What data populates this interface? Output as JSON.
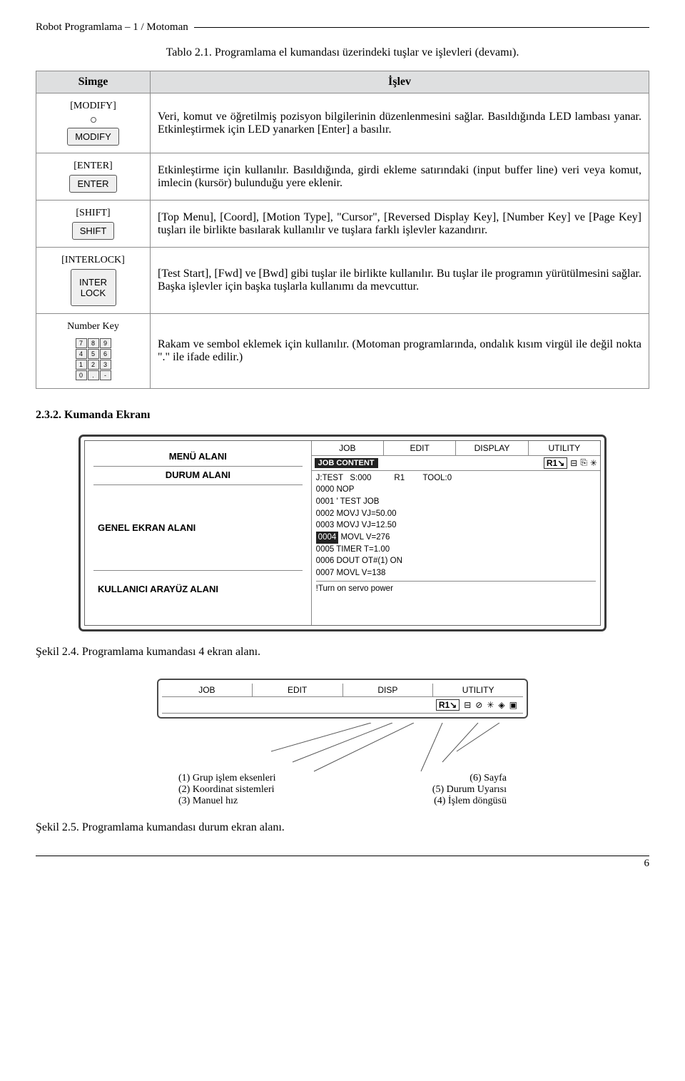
{
  "header": "Robot Programlama – 1 / Motoman",
  "table_caption": "Tablo 2.1. Programlama el kumandası üzerindeki tuşlar ve işlevleri (devamı).",
  "table": {
    "headers": {
      "col1": "Simge",
      "col2": "İşlev"
    },
    "rows": [
      {
        "icon_label": "[MODIFY]",
        "btn_text": "MODIFY",
        "has_led": true,
        "desc": "Veri, komut ve öğretilmiş pozisyon bilgilerinin düzenlenmesini sağlar. Basıldığında LED lambası yanar. Etkinleştirmek için LED yanarken [Enter] a basılır."
      },
      {
        "icon_label": "[ENTER]",
        "btn_text": "ENTER",
        "has_led": false,
        "desc": "Etkinleştirme için kullanılır. Basıldığında, girdi ekleme satırındaki (input buffer line) veri veya komut, imlecin (kursör) bulunduğu yere eklenir."
      },
      {
        "icon_label": "[SHIFT]",
        "btn_text": "SHIFT",
        "has_led": false,
        "desc": "[Top Menu], [Coord], [Motion Type], \"Cursor\", [Reversed Display Key], [Number Key] ve [Page Key] tuşları ile birlikte basılarak kullanılır ve tuşlara farklı işlevler kazandırır."
      },
      {
        "icon_label": "[INTERLOCK]",
        "btn_text_1": "INTER",
        "btn_text_2": "LOCK",
        "tall": true,
        "desc": "[Test Start], [Fwd] ve [Bwd] gibi tuşlar ile birlikte kullanılır. Bu tuşlar ile programın yürütülmesini sağlar. Başka işlevler için başka tuşlarla kullanımı da mevcuttur."
      },
      {
        "icon_label": "Number Key",
        "numpad": [
          [
            "7",
            "8",
            "9"
          ],
          [
            "4",
            "5",
            "6"
          ],
          [
            "1",
            "2",
            "3"
          ],
          [
            "0",
            ".",
            "-"
          ]
        ],
        "desc": "Rakam ve sembol eklemek için kullanılır. (Motoman programlarında, ondalık kısım virgül ile değil nokta \".\" ile ifade edilir.)"
      }
    ]
  },
  "section_2_3_2": "2.3.2. Kumanda Ekranı",
  "screen": {
    "left": {
      "menu": "MENÜ ALANI",
      "status": "DURUM ALANI",
      "main": "GENEL EKRAN ALANI",
      "ui": "KULLANICI ARAYÜZ ALANI"
    },
    "right": {
      "tabs": [
        "JOB",
        "EDIT",
        "DISPLAY",
        "UTILITY"
      ],
      "sub_left": "JOB CONTENT",
      "sub_right": "R1",
      "info_line": "J:TEST   S:000          R1        TOOL:0",
      "lines": [
        "0000 NOP",
        "0001 ' TEST JOB",
        "0002 MOVJ VJ=50.00",
        "0003 MOVJ VJ=12.50",
        {
          "hl": "0004",
          "rest": " MOVL V=276"
        },
        "0005 TIMER T=1.00",
        "0006 DOUT OT#(1) ON",
        "0007 MOVL V=138"
      ],
      "footer": "!Turn on servo power"
    }
  },
  "fig24": "Şekil 2.4. Programlama kumandası 4 ekran alanı.",
  "status_panel": {
    "tabs": [
      "JOB",
      "EDIT",
      "DISP",
      "UTILITY"
    ],
    "badge": "R1"
  },
  "annotations": {
    "left": [
      "(1) Grup işlem eksenleri",
      "(2) Koordinat sistemleri",
      "(3) Manuel hız"
    ],
    "right": [
      "(6) Sayfa",
      "(5) Durum Uyarısı",
      "(4) İşlem döngüsü"
    ]
  },
  "fig25": "Şekil 2.5. Programlama kumandası durum ekran alanı.",
  "page_number": "6"
}
